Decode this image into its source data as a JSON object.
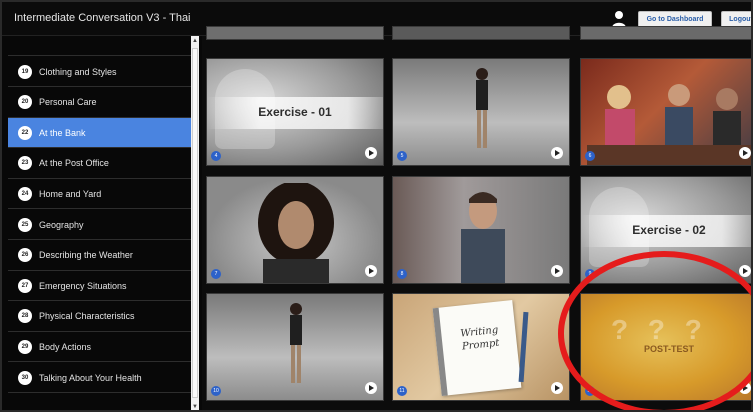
{
  "header": {
    "title": "Intermediate Conversation V3 - Thai",
    "dashboard_label": "Go to Dashboard",
    "logout_label": "Logout"
  },
  "sidebar": {
    "items": [
      {
        "num": "19",
        "label": "Clothing and Styles",
        "active": false
      },
      {
        "num": "20",
        "label": "Personal Care",
        "active": false
      },
      {
        "num": "22",
        "label": "At the Bank",
        "active": true
      },
      {
        "num": "23",
        "label": "At the Post Office",
        "active": false
      },
      {
        "num": "24",
        "label": "Home and Yard",
        "active": false
      },
      {
        "num": "25",
        "label": "Geography",
        "active": false
      },
      {
        "num": "26",
        "label": "Describing the Weather",
        "active": false
      },
      {
        "num": "27",
        "label": "Emergency Situations",
        "active": false
      },
      {
        "num": "28",
        "label": "Physical Characteristics",
        "active": false
      },
      {
        "num": "29",
        "label": "Body Actions",
        "active": false
      },
      {
        "num": "30",
        "label": "Talking About Your Health",
        "active": false
      }
    ]
  },
  "grid": {
    "tiles": [
      {
        "num": "4",
        "kind": "exercise",
        "title": "Exercise - 01"
      },
      {
        "num": "5",
        "kind": "person-full"
      },
      {
        "num": "6",
        "kind": "meeting"
      },
      {
        "num": "7",
        "kind": "person-closeup"
      },
      {
        "num": "8",
        "kind": "man-closeup"
      },
      {
        "num": "9",
        "kind": "exercise",
        "title": "Exercise - 02"
      },
      {
        "num": "10",
        "kind": "person-full"
      },
      {
        "num": "11",
        "kind": "writing",
        "title": "Writing Prompt"
      },
      {
        "num": "12",
        "kind": "posttest",
        "title": "POST-TEST"
      }
    ]
  },
  "colors": {
    "accent": "#4a84e0",
    "highlight": "#e51c1c",
    "badge": "#2d62c9"
  }
}
